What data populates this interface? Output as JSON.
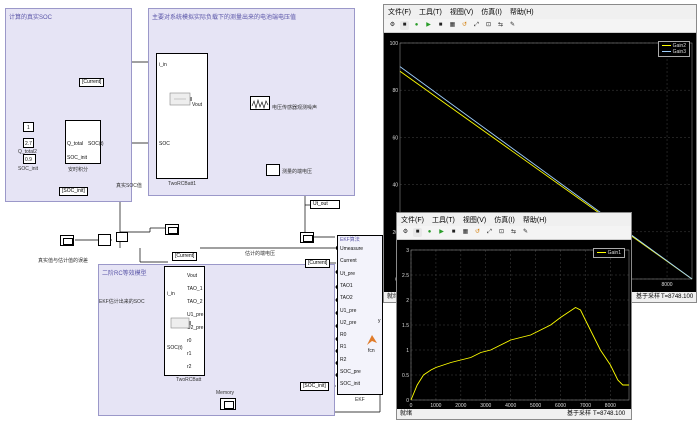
{
  "model": {
    "soc_subsystem_title": "计算的真实SOC",
    "sim_subsystem_title": "主要对系统模拟实际负载下的测量出来的电池端电压值",
    "soc_sum_label": "安时积分",
    "q_total_label": "Q_total2",
    "soc_init_label": "SOC_init",
    "const_1": "1",
    "const_qtotal": "2.7",
    "const_soc_init": "0.9",
    "soc_block_port_q": "Q_total",
    "soc_block_port_socinit": "SOC_init",
    "soc_block_port_out": "SOC(t)",
    "goto_current_top": "[Current]",
    "goto_soc_init_top": "[SOC_init]",
    "twocell1_label": "TwoRCBatt1",
    "twocell1_port_i": "i_in",
    "twocell1_port_soc": "SOC",
    "twocell1_port_vout": "Vout",
    "noise_label": "电压传感器观测噪声",
    "measured_voltage_label": "测量的端电压",
    "true_soc_label": "真实SOC值",
    "ut_out_label": "Ut_out",
    "error_label": "真实值与估计值的误差",
    "ekf_model_title": "二阶RC等效模型",
    "ekf_estimate_label": "EKF估计出来的SOC",
    "goto_current_mid": "[Current]",
    "goto_current_ekf": "[Current]",
    "goto_soc_init_bottom": "[SOC_init]",
    "est_voltage_label": "估计的端电压",
    "twocell2_label": "TwoRCBatt",
    "twocell2_port_i": "i_in",
    "twocell2_port_soc": "SOC(t)",
    "twocell2_ports": [
      "Vout",
      "TAO_1",
      "TAO_2",
      "U1_pre",
      "U2_pre",
      "r0",
      "r1",
      "r2"
    ],
    "ekf_title": "EKF算法",
    "ekf_ports": [
      "Umeasure",
      "Current",
      "Ut_pre",
      "TAO1",
      "TAO2",
      "U1_pre",
      "U2_pre",
      "R0",
      "R1",
      "R2",
      "SOC_pre",
      "SOC_init"
    ],
    "ekf_block_label": "EKF",
    "ekf_fcn_label": "fcn",
    "ekf_output": "y",
    "memory_label": "Memory"
  },
  "scope1": {
    "menu": [
      "文件(F)",
      "工具(T)",
      "视图(V)",
      "仿真(I)",
      "帮助(H)"
    ],
    "legend": [
      "Gain2",
      "Gain3"
    ],
    "legend_colors": [
      "#ffff00",
      "#9fd0ff"
    ],
    "y_ticks": [
      "100",
      "80",
      "60",
      "40",
      "20",
      "0"
    ],
    "x_ticks": [
      "8000"
    ],
    "status_left": "就绪",
    "status_mid": "基于采样",
    "status_time": "T=8748.100"
  },
  "scope2": {
    "menu": [
      "文件(F)",
      "工具(T)",
      "视图(V)",
      "仿真(I)",
      "帮助(H)"
    ],
    "legend": [
      "Gain1"
    ],
    "legend_colors": [
      "#ffff00"
    ],
    "y_ticks": [
      "3",
      "2.5",
      "2",
      "1.5",
      "1",
      "0.5",
      "0"
    ],
    "x_ticks": [
      "0",
      "1000",
      "2000",
      "3000",
      "4000",
      "5000",
      "6000",
      "7000",
      "8000"
    ],
    "status_left": "就绪",
    "status_mid": "基于采样",
    "status_time": "T=8748.100"
  },
  "chart_data": [
    {
      "type": "line",
      "series": [
        {
          "name": "Gain2",
          "x": [
            0,
            8748
          ],
          "y": [
            88,
            0
          ]
        },
        {
          "name": "Gain3",
          "x": [
            0,
            8748
          ],
          "y": [
            90,
            0
          ]
        }
      ],
      "xlim": [
        0,
        8748
      ],
      "ylim": [
        0,
        100
      ],
      "grid": true,
      "legend": "top-right"
    },
    {
      "type": "line",
      "series": [
        {
          "name": "Gain1",
          "x": [
            0,
            250,
            500,
            800,
            1000,
            1300,
            1600,
            2000,
            2400,
            2800,
            3200,
            3600,
            4000,
            4400,
            4800,
            5200,
            5600,
            6000,
            6300,
            6600,
            6800,
            7000,
            7300,
            7600,
            8000,
            8300,
            8500,
            8748
          ],
          "y": [
            0.0,
            0.3,
            0.5,
            0.6,
            0.65,
            0.7,
            0.75,
            0.8,
            0.85,
            0.95,
            1.0,
            1.1,
            1.2,
            1.25,
            1.3,
            1.4,
            1.5,
            1.65,
            1.75,
            1.85,
            1.8,
            1.6,
            1.3,
            1.0,
            0.7,
            0.4,
            0.3,
            0.3
          ]
        }
      ],
      "xlim": [
        0,
        8748
      ],
      "ylim": [
        0,
        3
      ],
      "grid": true,
      "legend": "top-right"
    }
  ]
}
